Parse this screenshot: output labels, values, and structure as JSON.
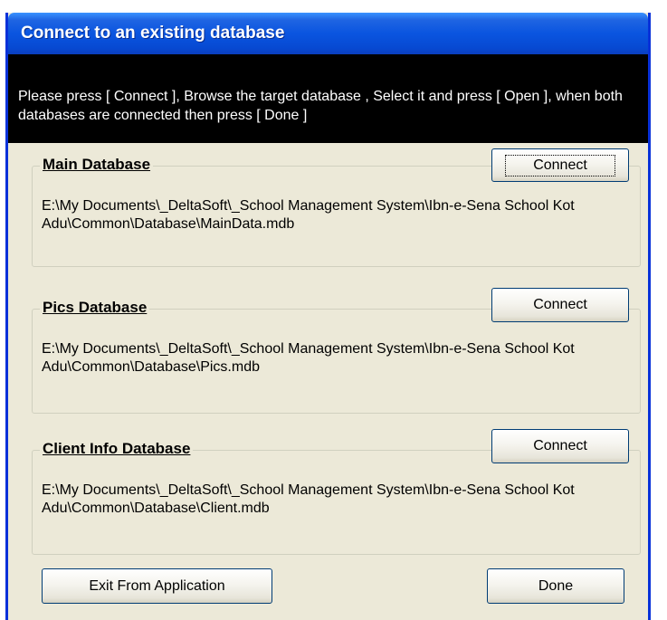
{
  "window": {
    "title": "Connect to an existing database"
  },
  "instructions": {
    "text": "Please press [ Connect ], Browse the target database , Select it and press [ Open ], when both databases are connected then press [ Done ]"
  },
  "groups": {
    "main": {
      "title": "Main Database",
      "connect_label": "Connect",
      "path": "E:\\My Documents\\_DeltaSoft\\_School Management System\\Ibn-e-Sena School Kot Adu\\Common\\Database\\MainData.mdb"
    },
    "pics": {
      "title": "Pics Database",
      "connect_label": "Connect",
      "path": "E:\\My Documents\\_DeltaSoft\\_School Management System\\Ibn-e-Sena School Kot Adu\\Common\\Database\\Pics.mdb"
    },
    "client": {
      "title": "Client Info Database",
      "connect_label": "Connect",
      "path": "E:\\My Documents\\_DeltaSoft\\_School Management System\\Ibn-e-Sena School Kot Adu\\Common\\Database\\Client.mdb"
    }
  },
  "footer": {
    "exit_label": "Exit From Application",
    "done_label": "Done"
  },
  "colors": {
    "titlebar": "#0a55e0",
    "window_bg": "#ece9d8",
    "instructions_bg": "#000000",
    "instructions_text": "#ffffff"
  }
}
